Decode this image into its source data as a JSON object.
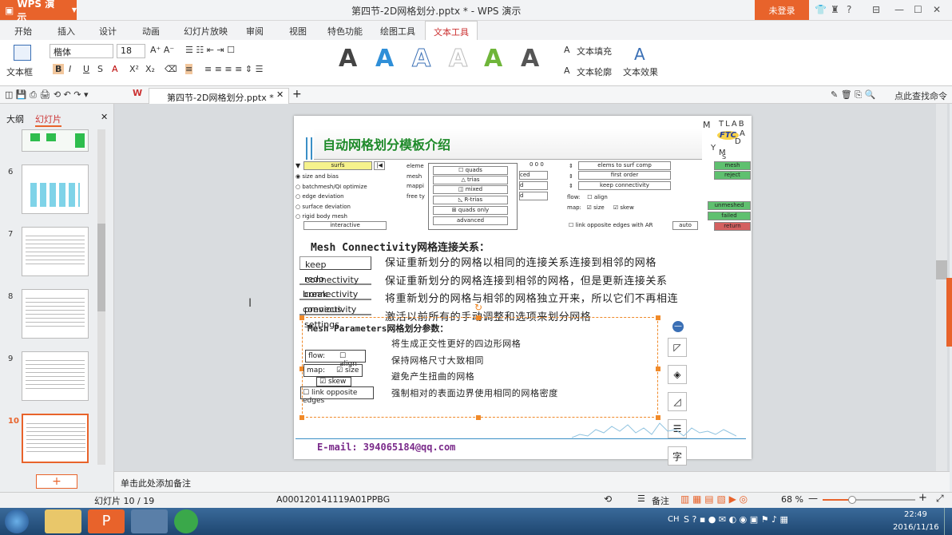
{
  "app": {
    "name": "WPS 演示",
    "doc_title": "第四节-2D网格划分.pptx * - WPS 演示",
    "login": "未登录"
  },
  "menu": [
    "开始",
    "插入",
    "设计",
    "动画",
    "幻灯片放映",
    "审阅",
    "视图",
    "特色功能",
    "绘图工具",
    "文本工具"
  ],
  "ribbon": {
    "textbox": "文本框",
    "font": "楷体",
    "size": "18",
    "fill": "文本填充",
    "outline": "文本轮廓",
    "effect": "文本效果"
  },
  "tabs": {
    "doc": "第四节-2D网格划分.pptx *",
    "search": "点此查找命令"
  },
  "panel": {
    "outline": "大纲",
    "slides": "幻灯片",
    "nums": [
      "6",
      "7",
      "8",
      "9",
      "10"
    ]
  },
  "slide": {
    "title": "自动网格划分模板介绍",
    "logo": [
      "M",
      "TLAB",
      "FTC",
      "A",
      "D",
      "Y",
      "M",
      "S"
    ],
    "panel_left": {
      "tab": "surfs",
      "radios": [
        "size and bias",
        "batchmesh/QI optimize",
        "edge deviation",
        "surface deviation",
        "rigid body mesh"
      ],
      "interactive": "interactive"
    },
    "panel_mid_labels": [
      "eleme",
      "mesh",
      "mappi",
      "free ty"
    ],
    "popup": [
      "quads",
      "trias",
      "mixed",
      "R-trias",
      "quads only",
      "advanced"
    ],
    "mid2": [
      "0 0 0",
      "ced",
      "d",
      "d"
    ],
    "panel_right": [
      "elems to surf comp",
      "first order",
      "keep connectivity"
    ],
    "flow_row": {
      "flow": "flow:",
      "align": "align",
      "map": "map:",
      "size": "size",
      "skew": "skew"
    },
    "link_opp": "link opposite edges with AR",
    "auto": "auto",
    "green_btns": [
      "mesh",
      "reject",
      "unmeshed",
      "failed",
      "return"
    ],
    "conn_heading": "Mesh Connectivity网格连接关系：",
    "conn_btns": [
      "keep connectivity",
      "redo connectivity",
      "break connectivity",
      "previous settings"
    ],
    "conn_lines": [
      "保证重新划分的网格以相同的连接关系连接到相邻的网格",
      "保证重新划分的网格连接到相邻的网格，但是更新连接关系",
      "将重新划分的网格与相邻的网格独立开来，所以它们不再相连",
      "激活以前所有的手动调整和选项来划分网格"
    ],
    "param_heading": "Mesh Parameters网格划分参数：",
    "param_btns": {
      "flow": "flow:",
      "align": "align",
      "map": "map:",
      "size": "size",
      "skew": "skew",
      "link": "link opposite edges"
    },
    "param_lines": [
      "将生成正交性更好的四边形网格",
      "保持网格尺寸大致相同",
      "避免产生扭曲的网格",
      "强制相对的表面边界使用相同的网格密度"
    ],
    "email": "E-mail: 394065184@qq.com"
  },
  "notes": "单击此处添加备注",
  "status": {
    "slide_pos": "幻灯片 10 / 19",
    "template": "A000120141119A01PPBG",
    "notes": "备注",
    "zoom": "68 %"
  },
  "taskbar": {
    "lang": "CH",
    "time": "22:49",
    "date": "2016/11/16"
  }
}
